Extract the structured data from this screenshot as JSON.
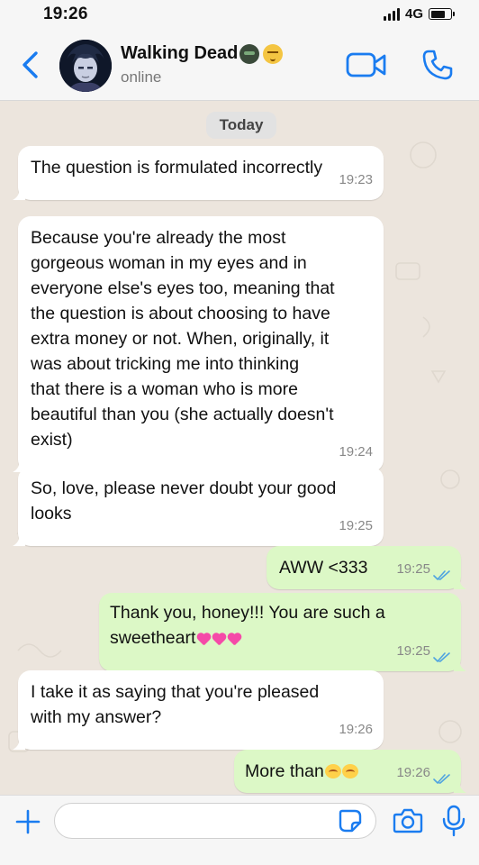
{
  "status_bar": {
    "time": "19:26",
    "network": "4G",
    "battery_level": 0.75
  },
  "header": {
    "contact_name": "Walking Dead",
    "contact_status": "online",
    "accent_color": "#1a7cf0"
  },
  "chat": {
    "date_label": "Today",
    "messages": [
      {
        "direction": "in",
        "text": "The question is formulated incorrectly",
        "time": "19:23"
      },
      {
        "direction": "in",
        "text": "Because you're already the most\ngorgeous woman in my eyes and in\neveryone else's eyes too, meaning that\nthe question is about choosing to have\nextra money or not. When, originally, it\nwas about tricking me into thinking\nthat there is a woman who is more\nbeautiful than you (she actually doesn't\nexist)",
        "time": "19:24"
      },
      {
        "direction": "in",
        "text": "So, love, please never doubt your good\nlooks",
        "time": "19:25"
      },
      {
        "direction": "out",
        "text": "AWW <333",
        "time": "19:25",
        "read": true
      },
      {
        "direction": "out",
        "text": "Thank you, honey!!! You are such a\nsweetheart",
        "time": "19:25",
        "read": true
      },
      {
        "direction": "in",
        "text": "I take it as saying that you're pleased\nwith my answer?",
        "time": "19:26"
      },
      {
        "direction": "out",
        "text": "More than",
        "time": "19:26",
        "read": true
      }
    ]
  },
  "composer": {
    "placeholder": "",
    "value": ""
  },
  "colors": {
    "incoming_bubble": "#ffffff",
    "outgoing_bubble": "#dcf8c6",
    "read_ticks": "#4fa3e0",
    "chat_background": "#ece5dd"
  }
}
